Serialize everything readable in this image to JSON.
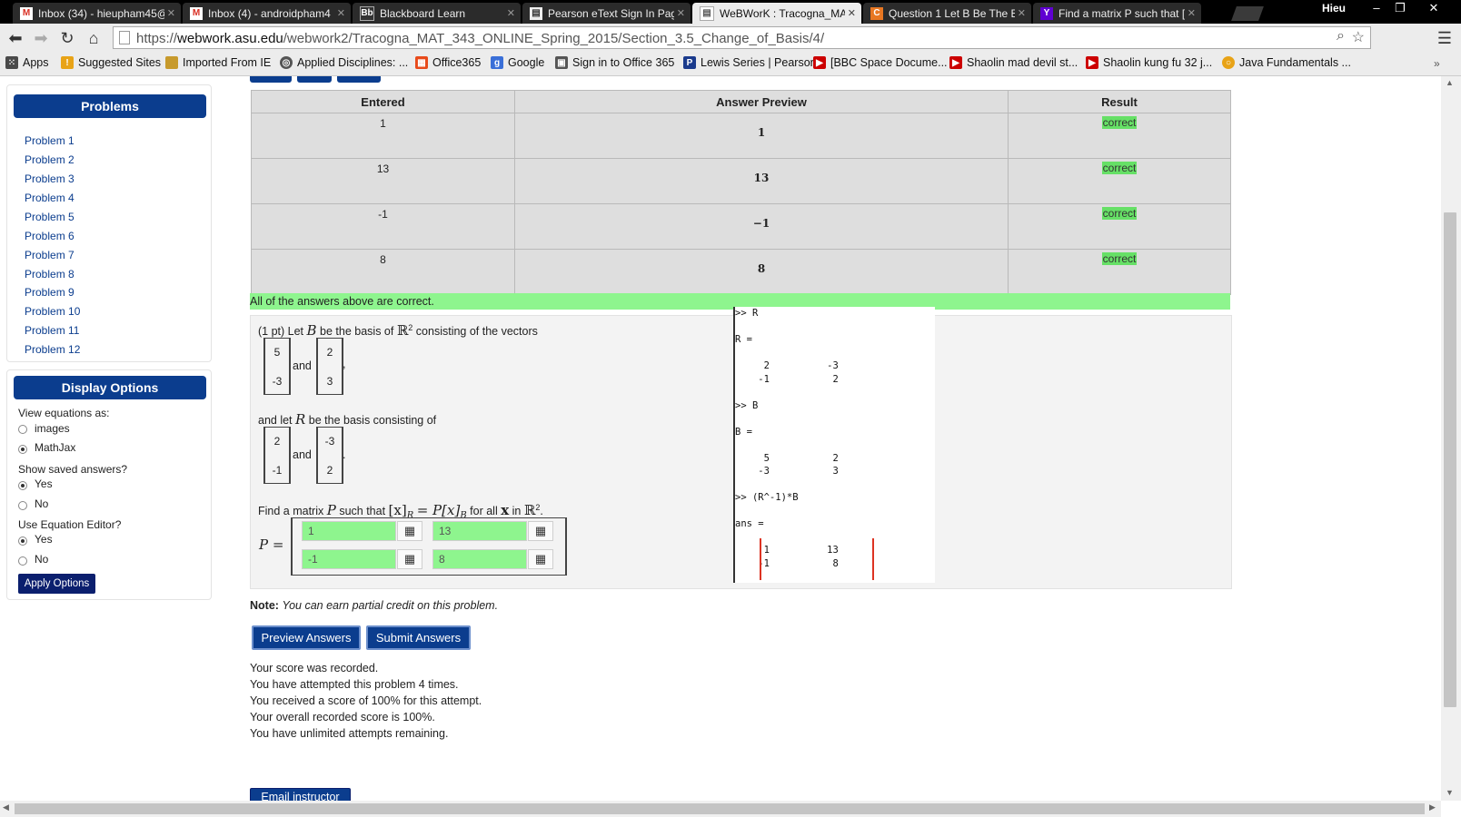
{
  "browser": {
    "tabs": [
      {
        "label": "Inbox (34) - hieupham45@",
        "icon": "gmail-icon",
        "color": "#d93025"
      },
      {
        "label": "Inbox (4) - androidpham4",
        "icon": "gmail-icon",
        "color": "#d93025"
      },
      {
        "label": "Blackboard Learn",
        "icon": "blackboard-icon",
        "color": "#333333"
      },
      {
        "label": "Pearson eText Sign In Pag",
        "icon": "page-icon",
        "color": "#dddddd"
      },
      {
        "label": "WeBWorK : Tracogna_MA",
        "icon": "page-icon",
        "color": "#ffffff"
      },
      {
        "label": "Question 1 Let B Be The B",
        "icon": "chegg-icon",
        "color": "#e87722"
      },
      {
        "label": "Find a matrix P such that [",
        "icon": "yahoo-icon",
        "color": "#6001d2"
      }
    ],
    "user": "Hieu",
    "url_prefix": "https://",
    "url_host": "webwork.asu.edu",
    "url_path": "/webwork2/Tracogna_MAT_343_ONLINE_Spring_2015/Section_3.5_Change_of_Basis/4/",
    "bookmarks": [
      {
        "label": "Apps",
        "icon": "apps-icon",
        "color": "#4a4a4a"
      },
      {
        "label": "Suggested Sites",
        "icon": "suggested-icon",
        "color": "#e8a317"
      },
      {
        "label": "Imported From IE",
        "icon": "folder-icon",
        "color": "#c79a2c"
      },
      {
        "label": "Applied Disciplines: ...",
        "icon": "globe-icon",
        "color": "#555555"
      },
      {
        "label": "Office365",
        "icon": "office-icon",
        "color": "#e84a1a"
      },
      {
        "label": "Google",
        "icon": "google-icon",
        "color": "#3a6fd8"
      },
      {
        "label": "Sign in to Office 365",
        "icon": "lock-icon",
        "color": "#555555"
      },
      {
        "label": "Lewis Series | Pearson",
        "icon": "pearson-icon",
        "color": "#1a3a8c"
      },
      {
        "label": "[BBC Space Docume...",
        "icon": "youtube-icon",
        "color": "#cc0000"
      },
      {
        "label": "Shaolin mad devil st...",
        "icon": "youtube-icon",
        "color": "#cc0000"
      },
      {
        "label": "Shaolin kung fu 32 j...",
        "icon": "youtube-icon",
        "color": "#cc0000"
      },
      {
        "label": "Java Fundamentals ...",
        "icon": "java-icon",
        "color": "#e8a317"
      }
    ]
  },
  "sidebar": {
    "problems_title": "Problems",
    "problems": [
      "Problem 1",
      "Problem 2",
      "Problem 3",
      "Problem 4",
      "Problem 5",
      "Problem 6",
      "Problem 7",
      "Problem 8",
      "Problem 9",
      "Problem 10",
      "Problem 11",
      "Problem 12"
    ],
    "display_title": "Display Options",
    "view_equations_label": "View equations as:",
    "view_options": [
      "images",
      "MathJax"
    ],
    "view_selected": "MathJax",
    "saved_answers_label": "Show saved answers?",
    "saved_options": [
      "Yes",
      "No"
    ],
    "saved_selected": "Yes",
    "equation_editor_label": "Use Equation Editor?",
    "editor_options": [
      "Yes",
      "No"
    ],
    "editor_selected": "Yes",
    "apply_label": "Apply Options"
  },
  "results": {
    "headers": [
      "Entered",
      "Answer Preview",
      "Result"
    ],
    "rows": [
      {
        "entered": "1",
        "preview": "1",
        "result": "correct"
      },
      {
        "entered": "13",
        "preview": "13",
        "result": "correct"
      },
      {
        "entered": "-1",
        "preview": "−1",
        "result": "correct"
      },
      {
        "entered": "8",
        "preview": "8",
        "result": "correct"
      }
    ],
    "summary": "All of the answers above are correct."
  },
  "problem": {
    "points": "(1 pt) Let",
    "B": "B",
    "intro_mid": "be the basis of",
    "R2": "ℝ",
    "sup2": "2",
    "intro_end": "consisting of the vectors",
    "B_vectors": [
      [
        "5",
        "-3"
      ],
      [
        "2",
        "3"
      ]
    ],
    "and": "and",
    "comma": ",",
    "period": ".",
    "let_R": "and let",
    "R": "R",
    "let_R_end": "be the basis consisting of",
    "R_vectors": [
      [
        "2",
        "-1"
      ],
      [
        "-3",
        "2"
      ]
    ],
    "find_text": "Find a matrix",
    "P": "P",
    "such_that": "such that",
    "equation": "[x]",
    "sub_R": "R",
    "eq_mid": "= P[x]",
    "sub_B": "B",
    "for_all": "for all",
    "x": "x",
    "in": "in",
    "P_eq": "P =",
    "answers": [
      "1",
      "13",
      "-1",
      "8"
    ],
    "note_label": "Note:",
    "note_text": "You can earn partial credit on this problem."
  },
  "terminal": {
    "lines": [
      ">> R",
      "",
      "R =",
      "",
      "     2          -3",
      "    -1           2",
      "",
      ">> B",
      "",
      "B =",
      "",
      "     5           2",
      "    -3           3",
      "",
      ">> (R^-1)*B",
      "",
      "ans =",
      "",
      "     1          13",
      "    -1           8"
    ]
  },
  "actions": {
    "preview": "Preview Answers",
    "submit": "Submit Answers",
    "email": "Email instructor"
  },
  "score": [
    "Your score was recorded.",
    "You have attempted this problem 4 times.",
    "You received a score of 100% for this attempt.",
    "Your overall recorded score is 100%.",
    "You have unlimited attempts remaining."
  ],
  "colors": {
    "accent": "#0b3d8e",
    "correct": "#8ef58e"
  }
}
